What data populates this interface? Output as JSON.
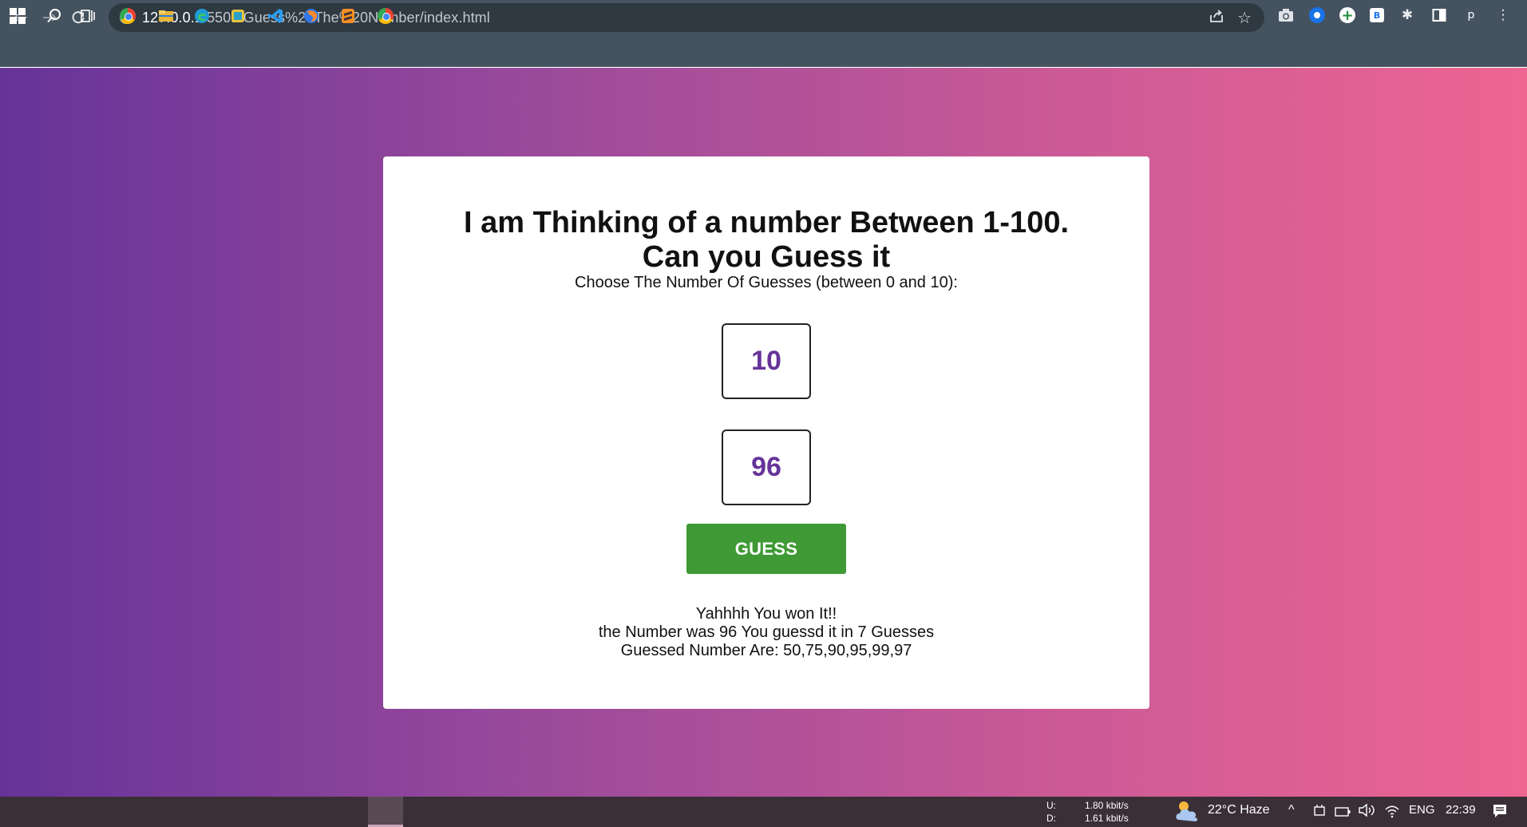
{
  "browser": {
    "url_host": "127.0.0.1",
    "url_path": ":5501/Guess%20The%20Number/index.html",
    "nav": {
      "back": "←",
      "forward": "→",
      "reload": "C"
    },
    "icons": [
      "share-icon",
      "star-icon",
      "camera-icon",
      "extension-circle-icon",
      "extension-plus-icon",
      "extension-b-icon",
      "puzzle-icon",
      "side-panel-icon",
      "profile-icon",
      "menu-icon"
    ],
    "ext_b_label": "B",
    "profile_label": "p"
  },
  "game": {
    "title_line1": "I am Thinking of a number Between 1-100.",
    "title_line2": "Can you Guess it",
    "subtitle": "Choose The Number Of Guesses (between 0 and 10):",
    "guesses_count": "10",
    "guess_value": "96",
    "guess_button": "GUESS",
    "result_line1": "Yahhhh You won It!!",
    "result_line2": "the Number was 96 You guessd it in 7 Guesses",
    "result_line3": "Guessed Number Are: 50,75,90,95,99,97"
  },
  "colors": {
    "gradient_start": "#663399",
    "gradient_end": "#ee6592",
    "number_text": "#663399",
    "button_green": "#3f9a35"
  },
  "taskbar": {
    "net_up_label": "U:",
    "net_down_label": "D:",
    "net_up": "1.80 kbit/s",
    "net_down": "1.61 kbit/s",
    "weather": "22°C  Haze",
    "language": "ENG",
    "time": "22:39"
  }
}
